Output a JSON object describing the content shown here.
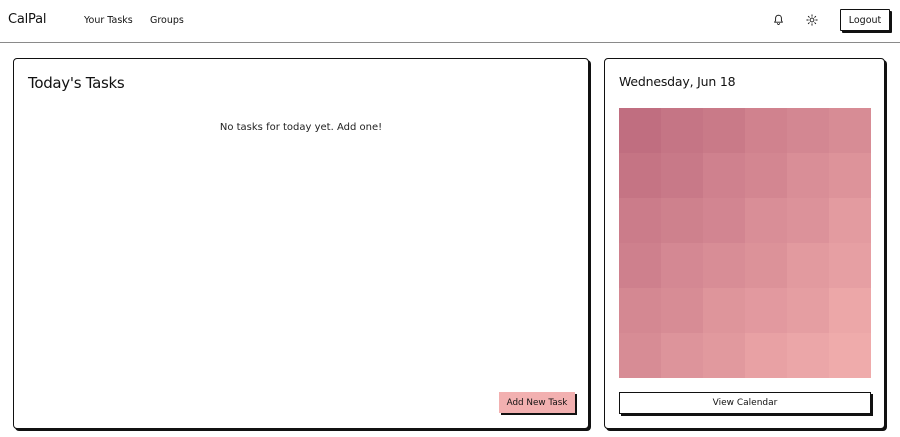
{
  "header": {
    "brand": "CalPal",
    "nav": [
      {
        "label": "Your Tasks"
      },
      {
        "label": "Groups"
      }
    ],
    "icons": {
      "notifications": "bell-icon",
      "theme": "sun-icon"
    },
    "logout_label": "Logout"
  },
  "tasks_panel": {
    "title": "Today's Tasks",
    "empty_message": "No tasks for today yet. Add one!",
    "add_button_label": "Add New Task"
  },
  "side_panel": {
    "date_label": "Wednesday, Jun 18",
    "view_calendar_label": "View Calendar"
  },
  "colors": {
    "accent": "#f2b0b0",
    "mosaic_dark": "#c06e80",
    "mosaic_light": "#f0acac",
    "border": "#111111"
  }
}
